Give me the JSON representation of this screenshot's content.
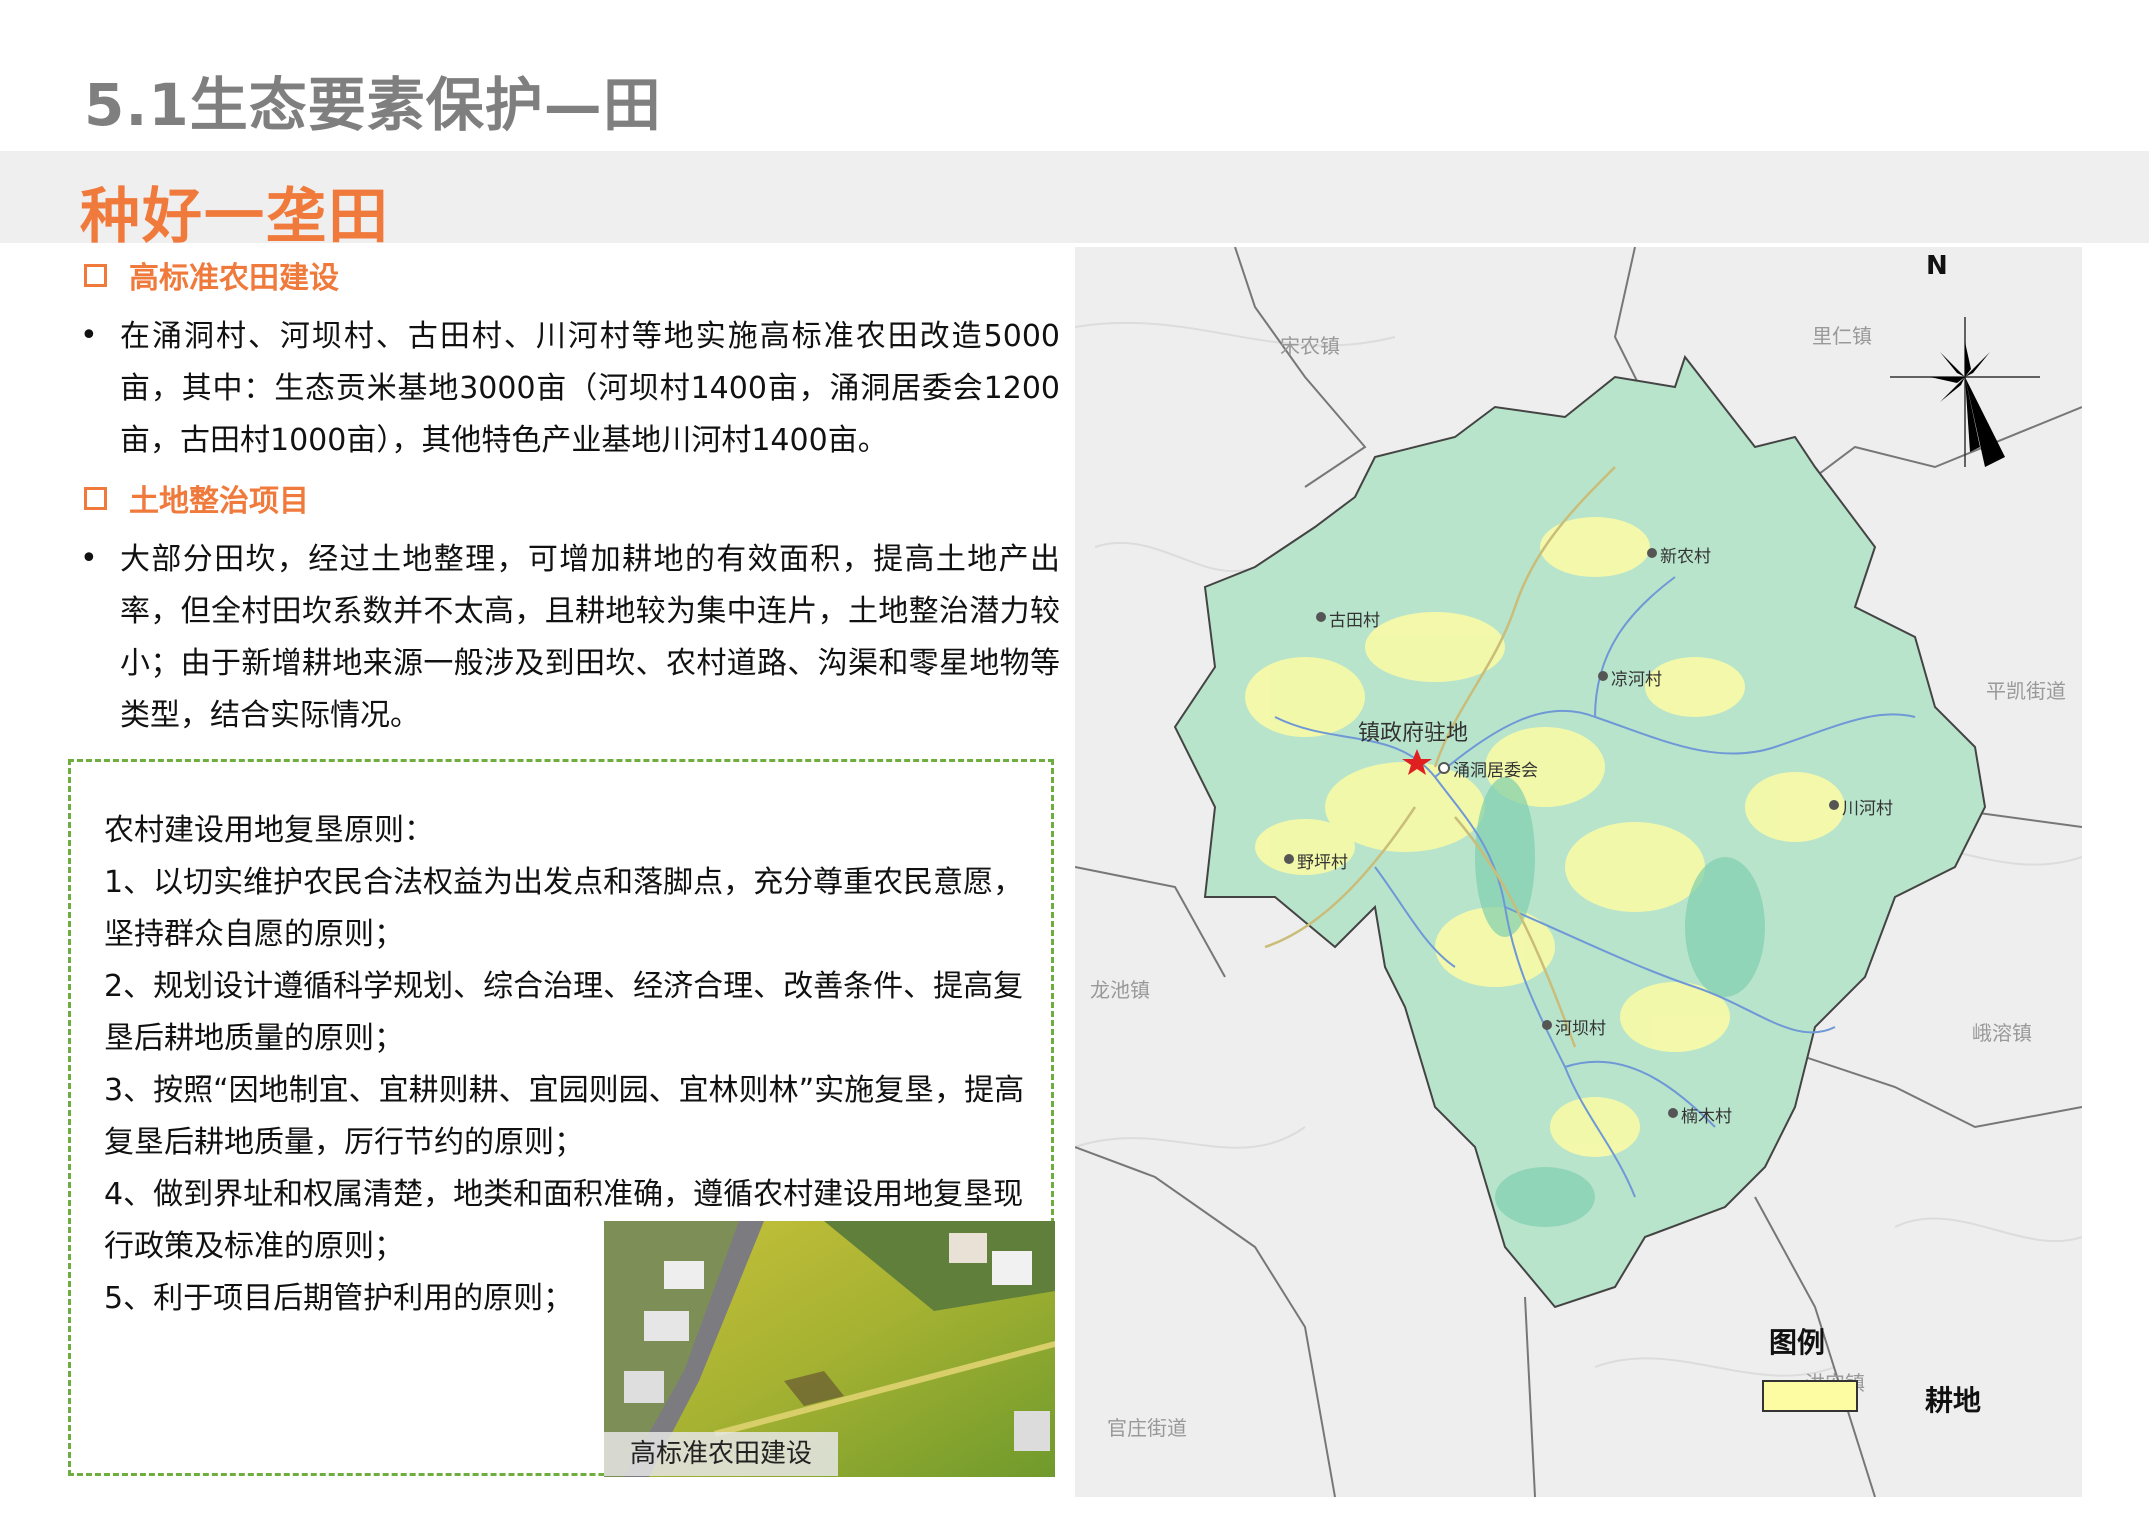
{
  "header": {
    "title": "5.1生态要素保护—田",
    "banner": "种好一垄田"
  },
  "sections": [
    {
      "heading": "高标准农田建设",
      "bullet": "•",
      "text": "在涌洞村、河坝村、古田村、川河村等地实施高标准农田改造5000亩，其中：生态贡米基地3000亩（河坝村1400亩，涌洞居委会1200亩，古田村1000亩），其他特色产业基地川河村1400亩。"
    },
    {
      "heading": "土地整治项目",
      "bullet": "•",
      "text": "大部分田坎，经过土地整理，可增加耕地的有效面积，提高土地产出率，但全村田坎系数并不太高，且耕地较为集中连片，土地整治潜力较小；由于新增耕地来源一般涉及到田坎、农村道路、沟渠和零星地物等类型，结合实际情况。"
    }
  ],
  "principles": {
    "intro": "农村建设用地复垦原则：",
    "items": [
      "1、以切实维护农民合法权益为出发点和落脚点，充分尊重农民意愿，坚持群众自愿的原则；",
      "2、规划设计遵循科学规划、综合治理、经济合理、改善条件、提高复垦后耕地质量的原则；",
      "3、按照“因地制宜、宜耕则耕、宜园则园、宜林则林”实施复垦，提高复垦后耕地质量，厉行节约的原则；",
      "4、做到界址和权属清楚，地类和面积准确，遵循农村建设用地复垦现行政策及标准的原则；",
      "5、利于项目后期管护利用的原则；"
    ]
  },
  "photo": {
    "caption": "高标准农田建设"
  },
  "map": {
    "north": "N",
    "towns": [
      "宋农镇",
      "里仁镇",
      "平凯街道",
      "龙池镇",
      "峨溶镇",
      "官庄街道",
      "洪安镇"
    ],
    "seat_label": "镇政府驻地",
    "villages": [
      "新农村",
      "古田村",
      "凉河村",
      "涌洞居委会",
      "川河村",
      "野坪村",
      "河坝村",
      "楠木村"
    ],
    "legend_title": "图例",
    "legend_item": "耕地",
    "colors": {
      "farmland": "#fdfca3",
      "water": "#6f98d6",
      "forest": "#a8dcc3"
    }
  }
}
